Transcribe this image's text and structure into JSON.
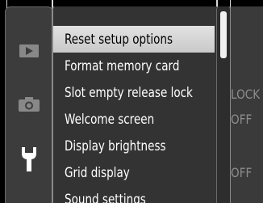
{
  "menu": {
    "items": [
      {
        "label": "Reset setup options",
        "selected": true
      },
      {
        "label": "Format memory card"
      },
      {
        "label": "Slot empty release lock"
      },
      {
        "label": "Welcome screen"
      },
      {
        "label": "Display brightness"
      },
      {
        "label": "Grid display"
      },
      {
        "label": "Sound settings"
      }
    ]
  },
  "values": {
    "slot_empty_release_lock": "LOCK",
    "welcome_screen": "OFF",
    "grid_display": "OFF"
  },
  "sidebar": {
    "icons": [
      "playback-icon",
      "camera-icon",
      "wrench-icon"
    ],
    "active": "wrench-icon"
  },
  "colors": {
    "selected_bg": "#d6d6d6",
    "panel_bg": "#333333",
    "value_text": "#8c8c8c"
  }
}
